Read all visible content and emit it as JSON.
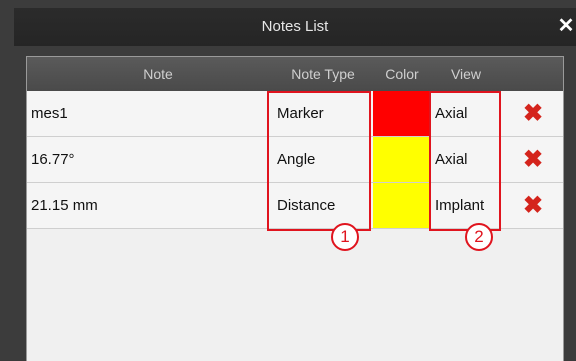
{
  "window": {
    "title": "Notes List",
    "close_glyph": "✕"
  },
  "columns": {
    "note": "Note",
    "note_type": "Note Type",
    "color": "Color",
    "view": "View"
  },
  "rows": [
    {
      "note": "mes1",
      "note_type": "Marker",
      "color": "#ff0000",
      "view": "Axial",
      "delete_glyph": "✖"
    },
    {
      "note": "16.77°",
      "note_type": "Angle",
      "color": "#ffff00",
      "view": "Axial",
      "delete_glyph": "✖"
    },
    {
      "note": "21.15 mm",
      "note_type": "Distance",
      "color": "#ffff00",
      "view": "Implant",
      "delete_glyph": "✖"
    }
  ],
  "callouts": [
    {
      "label": "1",
      "color": "#e0141e"
    },
    {
      "label": "2",
      "color": "#e0141e"
    }
  ]
}
